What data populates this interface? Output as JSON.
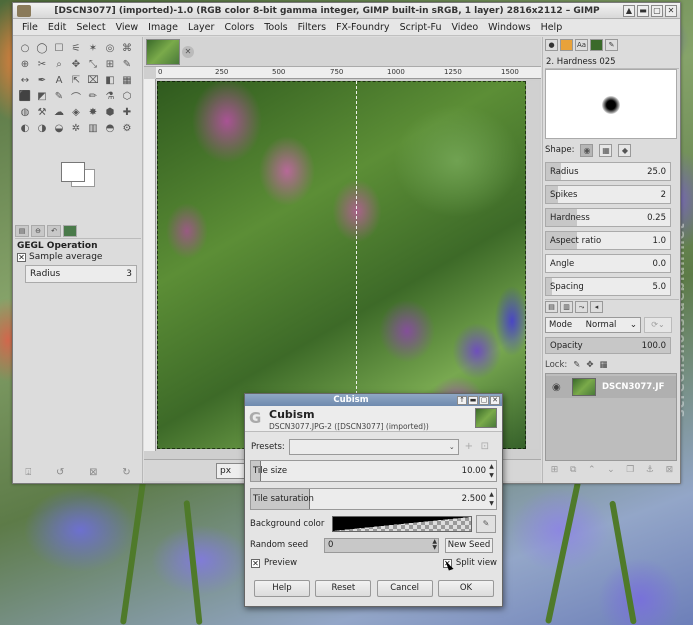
{
  "window": {
    "title": "[DSCN3077] (imported)-1.0 (RGB color 8-bit gamma integer, GIMP built-in sRGB, 1 layer) 2816x2112 – GIMP",
    "controls": [
      "▲",
      "▬",
      "▢",
      "✕"
    ]
  },
  "menubar": [
    "File",
    "Edit",
    "Select",
    "View",
    "Image",
    "Layer",
    "Colors",
    "Tools",
    "Filters",
    "FX-Foundry",
    "Script-Fu",
    "Video",
    "Windows",
    "Help"
  ],
  "toolbox": {
    "tools": [
      "○",
      "◯",
      "☐",
      "⚟",
      "✶",
      "◎",
      "⌘",
      "⊕",
      "✂",
      "⌕",
      "✥",
      "⤡",
      "⊞",
      "✎",
      "↔",
      "✒",
      "A",
      "⇱",
      "⌧",
      "◧",
      "▦",
      "⬛",
      "◩",
      "✎",
      "⌒",
      "✏",
      "⚗",
      "⬡",
      "◍",
      "⚒",
      "☁",
      "◈",
      "✸",
      "⬢",
      "✚",
      "◐",
      "◑",
      "◒",
      "✲",
      "▥",
      "◓",
      "⚙"
    ],
    "tool_options_title": "GEGL Operation",
    "sample_average_label": "Sample average",
    "radius_label": "Radius",
    "radius_value": "3"
  },
  "image": {
    "ruler_labels": [
      "0",
      "250",
      "500",
      "750",
      "1000",
      "1250",
      "1500"
    ],
    "unit": "px"
  },
  "brushes": {
    "name": "2. Hardness 025",
    "shape_label": "Shape:",
    "params": [
      {
        "label": "Radius",
        "value": "25.0",
        "fill": 0.12
      },
      {
        "label": "Spikes",
        "value": "2",
        "fill": 0.1
      },
      {
        "label": "Hardness",
        "value": "0.25",
        "fill": 0.25
      },
      {
        "label": "Aspect ratio",
        "value": "1.0",
        "fill": 0.25
      },
      {
        "label": "Angle",
        "value": "0.0",
        "fill": 0.0
      },
      {
        "label": "Spacing",
        "value": "5.0",
        "fill": 0.05
      }
    ]
  },
  "layers": {
    "mode_label": "Mode",
    "mode_value": "Normal",
    "opacity_label": "Opacity",
    "opacity_value": "100.0",
    "lock_label": "Lock:",
    "layer_name": "DSCN3077.JF"
  },
  "dialog": {
    "title": "Cubism",
    "plugin_name": "Cubism",
    "subtitle": "DSCN3077.JPG-2 ([DSCN3077] (imported))",
    "presets_label": "Presets:",
    "tile_size_label": "Tile size",
    "tile_size_value": "10.00",
    "tile_size_fill": 0.04,
    "tile_saturation_label": "Tile saturation",
    "tile_saturation_value": "2.500",
    "tile_saturation_fill": 0.24,
    "background_color_label": "Background color",
    "random_seed_label": "Random seed",
    "random_seed_value": "0",
    "new_seed_label": "New Seed",
    "preview_label": "Preview",
    "split_view_label": "Split view",
    "buttons": {
      "help": "Help",
      "reset": "Reset",
      "cancel": "Cancel",
      "ok": "OK"
    }
  },
  "watermark": "screenshots.debian.net"
}
